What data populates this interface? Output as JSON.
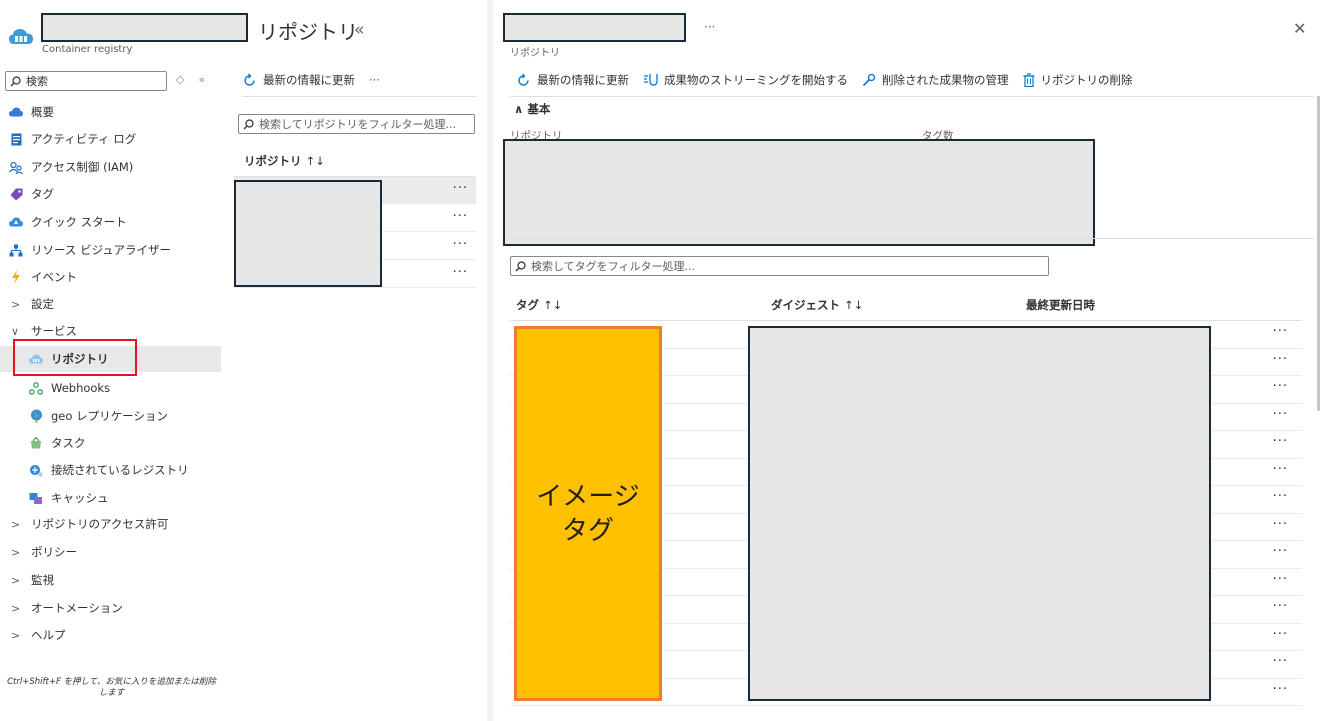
{
  "resource": {
    "subtitle": "Container registry",
    "search_placeholder": "検索",
    "nav_tool_up": "◇",
    "nav_tool_collapse": "«"
  },
  "nav": {
    "items": [
      {
        "label": "概要",
        "icon": "cloud-overview-icon"
      },
      {
        "label": "アクティビティ ログ",
        "icon": "activity-log-icon"
      },
      {
        "label": "アクセス制御 (IAM)",
        "icon": "iam-people-icon"
      },
      {
        "label": "タグ",
        "icon": "tag-icon"
      },
      {
        "label": "クイック スタート",
        "icon": "quickstart-cloud-icon"
      },
      {
        "label": "リソース ビジュアライザー",
        "icon": "resource-visualizer-icon"
      },
      {
        "label": "イベント",
        "icon": "lightning-icon"
      }
    ],
    "settings": "設定",
    "services": "サービス",
    "service_items": [
      {
        "label": "リポジトリ",
        "icon": "repository-cloud-icon",
        "active": true
      },
      {
        "label": "Webhooks",
        "icon": "webhooks-icon"
      },
      {
        "label": "geo レプリケーション",
        "icon": "globe-icon"
      },
      {
        "label": "タスク",
        "icon": "tasks-icon"
      },
      {
        "label": "接続されているレジストリ",
        "icon": "connected-registry-icon"
      },
      {
        "label": "キャッシュ",
        "icon": "cache-icon"
      }
    ],
    "collapsed": [
      "リポジトリのアクセス許可",
      "ポリシー",
      "監視",
      "オートメーション",
      "ヘルプ"
    ],
    "footer": "Ctrl+Shift+F を押して、お気に入りを追加または削除します"
  },
  "repos_pane": {
    "title": "リポジトリ",
    "collapse": "«",
    "refresh": "最新の情報に更新",
    "more": "···",
    "filter_placeholder": "検索してリポジトリをフィルター処理...",
    "column": "リポジトリ",
    "sort": "↑↓",
    "row_more": "···",
    "row_count": 4
  },
  "detail": {
    "more": "···",
    "close": "✕",
    "subtitle": "リポジトリ",
    "toolbar": {
      "refresh": "最新の情報に更新",
      "stream": "成果物のストリーミングを開始する",
      "manage": "削除された成果物の管理",
      "delete": "リポジトリの削除"
    },
    "essentials": "基本",
    "essentials_caret": "∧",
    "label_repository": "リポジトリ",
    "label_tag_count": "タグ数",
    "tag_filter_placeholder": "検索してタグをフィルター処理...",
    "columns": {
      "tag": "タグ",
      "digest": "ダイジェスト",
      "updated": "最終更新日時"
    },
    "sort": "↑↓",
    "row_more": "···",
    "row_count": 14,
    "annotation": "イメージタグ"
  },
  "colors": {
    "accent": "#0078d4",
    "highlight_border": "#e81123",
    "annotation_fill": "#ffc000",
    "annotation_border": "#ed7d31",
    "redaction": "#e6e6e6"
  }
}
